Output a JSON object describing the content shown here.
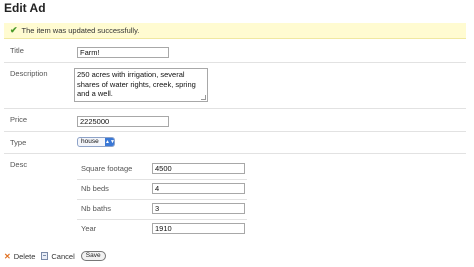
{
  "page": {
    "title": "Edit Ad"
  },
  "flash": {
    "message": "The item was updated successfully.",
    "icon": "check-icon"
  },
  "form": {
    "title": {
      "label": "Title",
      "value": "Farm!"
    },
    "description": {
      "label": "Description",
      "value": "250 acres with irrigation, several shares of water rights, creek, spring and a well."
    },
    "price": {
      "label": "Price",
      "value": "2225000"
    },
    "type": {
      "label": "Type",
      "selected": "house"
    },
    "desc": {
      "label": "Desc",
      "fields": [
        {
          "label": "Square footage",
          "value": "4500"
        },
        {
          "label": "Nb beds",
          "value": "4"
        },
        {
          "label": "Nb baths",
          "value": "3"
        },
        {
          "label": "Year",
          "value": "1910"
        }
      ]
    }
  },
  "actions": {
    "delete_label": "Delete",
    "cancel_label": "Cancel",
    "save_label": "Save"
  }
}
